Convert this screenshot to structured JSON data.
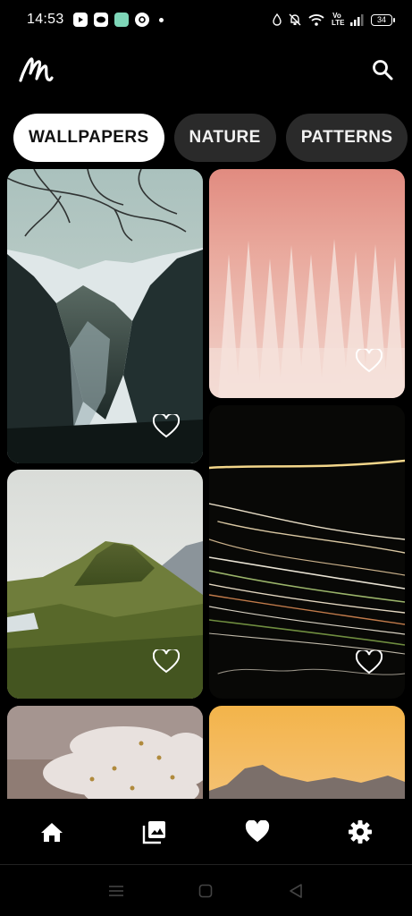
{
  "status_bar": {
    "time": "14:53",
    "battery": "34",
    "network_label": "Vo LTE",
    "notification_icons": [
      "youtube-icon",
      "messaging-icon",
      "app-icon",
      "app-icon"
    ]
  },
  "app_bar": {
    "logo_icon": "app-logo-icon",
    "search_icon": "search-icon"
  },
  "tabs": [
    {
      "label": "WALLPAPERS",
      "active": true
    },
    {
      "label": "NATURE",
      "active": false
    },
    {
      "label": "PATTERNS",
      "active": false
    }
  ],
  "wallpapers": [
    {
      "subject": "snowy-mountain-valley",
      "favorited": false
    },
    {
      "subject": "pink-frosted-forest",
      "favorited": false
    },
    {
      "subject": "light-trails",
      "favorited": false
    },
    {
      "subject": "green-hill-landscape",
      "favorited": false
    },
    {
      "subject": "abstract-sculpture",
      "favorited": false
    },
    {
      "subject": "orange-sky-mountains",
      "favorited": false
    }
  ],
  "bottom_nav": [
    {
      "icon": "home-icon"
    },
    {
      "icon": "gallery-icon"
    },
    {
      "icon": "heart-icon"
    },
    {
      "icon": "settings-icon"
    }
  ],
  "system_nav": [
    "menu-icon",
    "home-square-icon",
    "back-icon"
  ],
  "colors": {
    "background": "#000000",
    "tab_active_bg": "#ffffff",
    "tab_inactive_bg": "#2a2a2a"
  }
}
